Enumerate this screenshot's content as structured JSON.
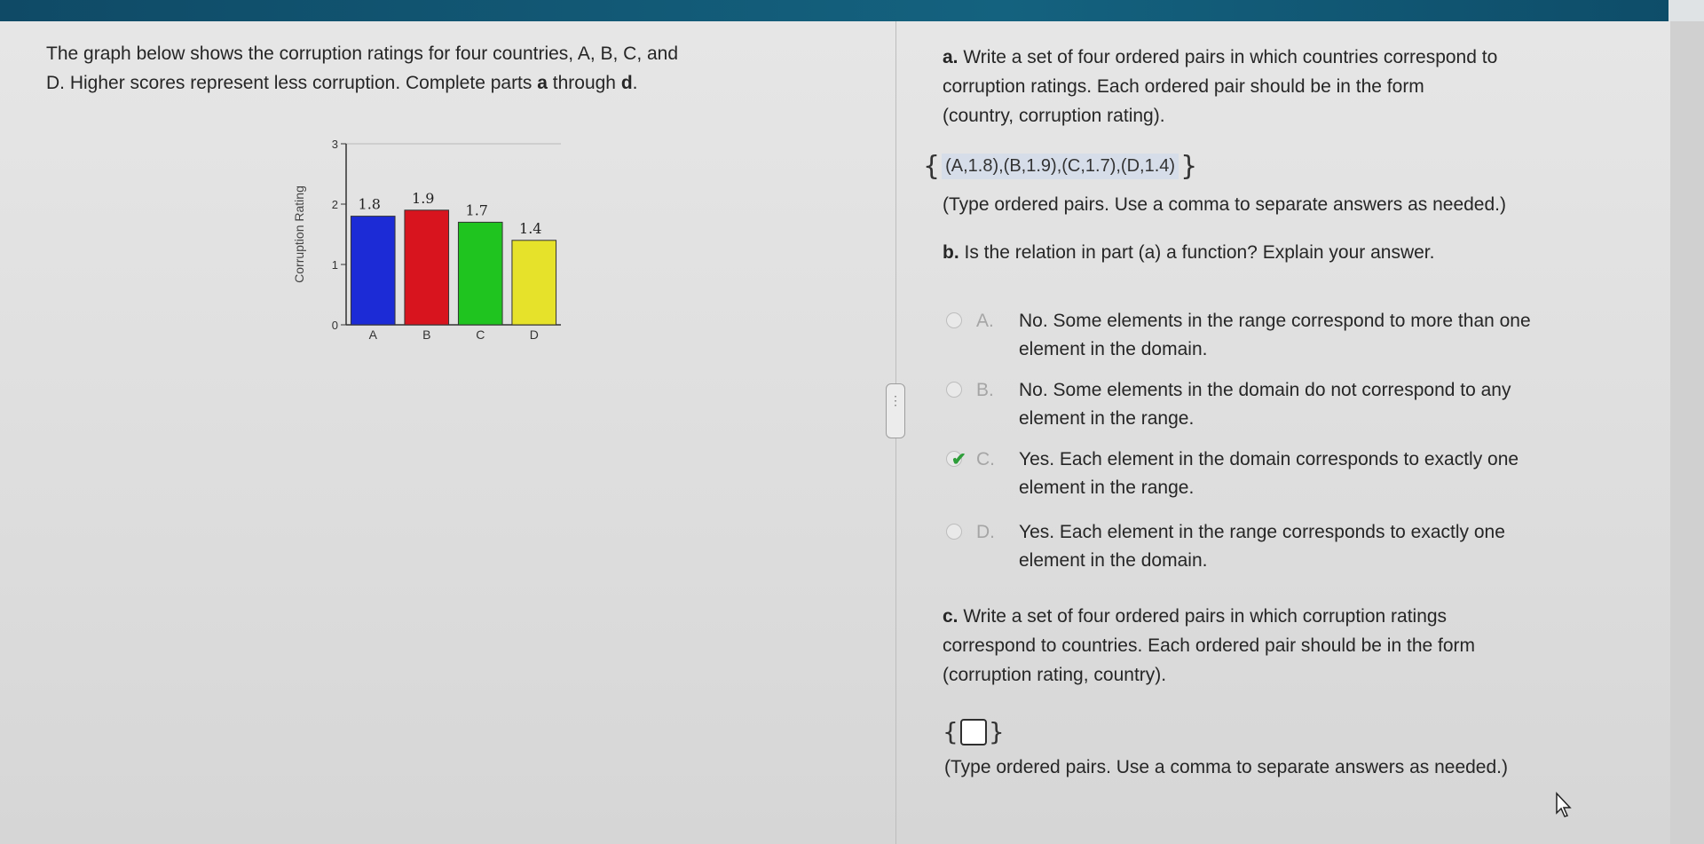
{
  "question_intro": {
    "line1": "The graph below shows the corruption ratings for four countries, A, B, C, and",
    "line2_pre": "D. Higher scores represent less corruption. Complete parts ",
    "bold_a": "a",
    "middle": " through ",
    "bold_d": "d",
    "end": "."
  },
  "chart_data": {
    "type": "bar",
    "categories": [
      "A",
      "B",
      "C",
      "D"
    ],
    "values": [
      1.8,
      1.9,
      1.7,
      1.4
    ],
    "data_labels": [
      "1.8",
      "1.9",
      "1.7",
      "1.4"
    ],
    "colors": [
      "#1c2bd6",
      "#d8141e",
      "#1fc41f",
      "#e6e22a"
    ],
    "ylabel": "Corruption Rating",
    "yticks": [
      "0",
      "1",
      "2",
      "3"
    ],
    "ylim": [
      0,
      3
    ]
  },
  "part_a": {
    "label": "a.",
    "text1": " Write a set of four ordered pairs in which countries correspond to",
    "text2": "corruption ratings. Each ordered pair should be in the form",
    "text3": "(country, corruption rating).",
    "open_brace": "{",
    "answer": "(A,1.8),(B,1.9),(C,1.7),(D,1.4)",
    "close_brace": "}",
    "hint": "(Type ordered pairs. Use a comma to separate answers as needed.)"
  },
  "part_b": {
    "label": "b.",
    "text": " Is the relation in part (a) a function? Explain your answer.",
    "options": [
      {
        "letter": "A.",
        "line1": "No. Some elements in the range correspond to more than one",
        "line2": "element in the domain."
      },
      {
        "letter": "B.",
        "line1": "No. Some elements in the domain do not correspond to any",
        "line2": "element in the range."
      },
      {
        "letter": "C.",
        "line1": "Yes. Each element in the domain corresponds to exactly one",
        "line2": "element in the range."
      },
      {
        "letter": "D.",
        "line1": "Yes. Each element in the range corresponds to exactly one",
        "line2": "element in the domain."
      }
    ],
    "selected": "C."
  },
  "part_c": {
    "label": "c.",
    "text1": " Write a set of four ordered pairs in which corruption ratings",
    "text2": "correspond to countries. Each ordered pair should be in the form",
    "text3": "(corruption rating, country).",
    "open_brace": "{",
    "close_brace": "}",
    "hint": "(Type ordered pairs. Use a comma to separate answers as needed.)"
  },
  "icons": {
    "cursor": "mouse-pointer-icon",
    "check": "checkmark-icon",
    "handle": "pane-resize-handle"
  }
}
